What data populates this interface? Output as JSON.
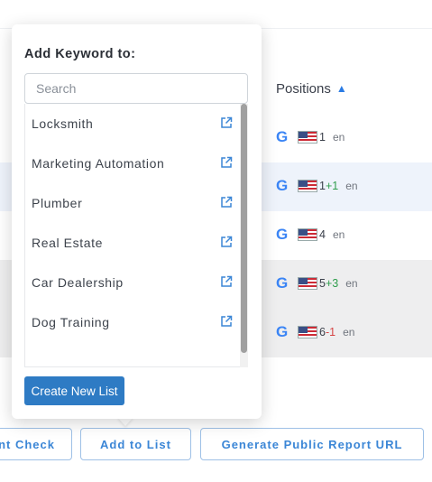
{
  "table": {
    "positions_header": "Positions",
    "rows": [
      {
        "engine": "G",
        "position": "1",
        "change": "",
        "lang": "en"
      },
      {
        "engine": "G",
        "position": "1",
        "change": "+1",
        "lang": "en"
      },
      {
        "engine": "G",
        "position": "4",
        "change": "",
        "lang": "en"
      },
      {
        "engine": "G",
        "position": "5",
        "change": "+3",
        "lang": "en"
      },
      {
        "engine": "G",
        "position": "6",
        "change": "-1",
        "lang": "en"
      }
    ]
  },
  "popover": {
    "title": "Add Keyword to:",
    "search_placeholder": "Search",
    "items": [
      {
        "label": "Locksmith"
      },
      {
        "label": "Marketing Automation"
      },
      {
        "label": "Plumber"
      },
      {
        "label": "Real Estate"
      },
      {
        "label": "Car Dealership"
      },
      {
        "label": "Dog Training"
      }
    ],
    "create_label": "Create New List"
  },
  "toolbar": {
    "check_label": "nt Check",
    "add_to_list_label": "Add to List",
    "report_label": "Generate Public Report URL"
  },
  "colors": {
    "accent": "#2e7bc4",
    "positive": "#2e9d4c",
    "negative": "#d64545"
  }
}
